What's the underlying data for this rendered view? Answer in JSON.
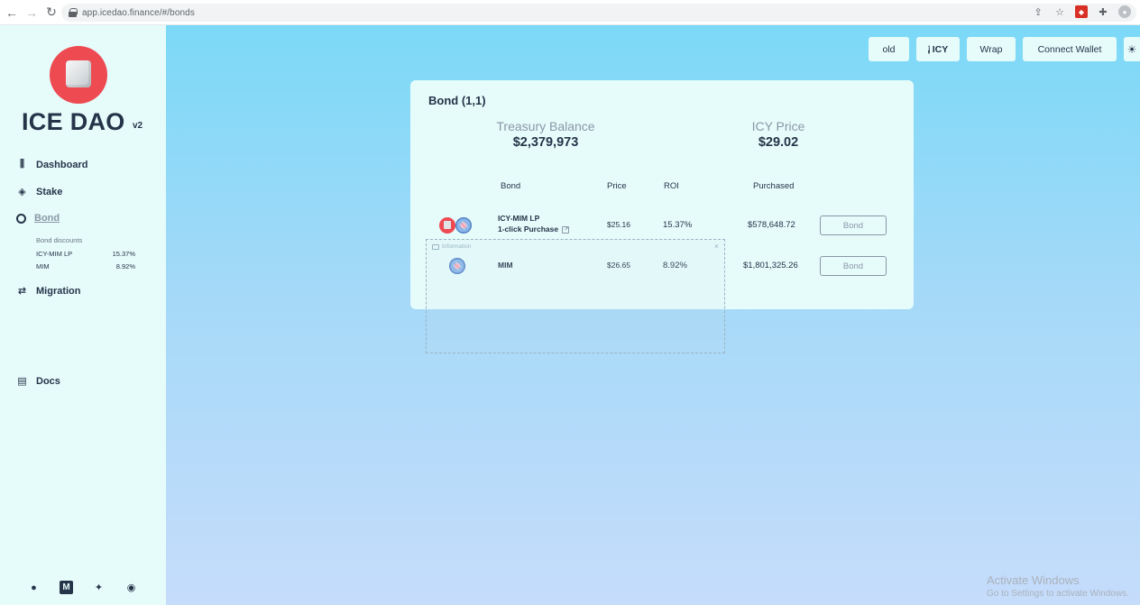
{
  "browser": {
    "url": "app.icedao.finance/#/bonds",
    "icons": [
      "back-arrow-icon",
      "forward-arrow-icon",
      "reload-icon",
      "lock-icon",
      "share-icon",
      "star-icon",
      "extension-icon",
      "puzzle-icon",
      "profile-icon"
    ]
  },
  "sidebar": {
    "brand": "ICE DAO",
    "version": "v2",
    "nav": [
      {
        "label": "Dashboard",
        "icon": "sliders-icon"
      },
      {
        "label": "Stake",
        "icon": "layers-icon"
      },
      {
        "label": "Bond",
        "icon": "bond-icon",
        "active": true
      },
      {
        "label": "Migration",
        "icon": "migration-icon"
      },
      {
        "label": "Docs",
        "icon": "docs-icon"
      }
    ],
    "discounts": {
      "title": "Bond discounts",
      "items": [
        {
          "name": "ICY-MIM LP",
          "value": "15.37%"
        },
        {
          "name": "MIM",
          "value": "8.92%"
        }
      ]
    },
    "socials": [
      "github-icon",
      "medium-icon",
      "twitter-icon",
      "discord-icon"
    ]
  },
  "topbar": {
    "old": "old",
    "icy": "ICY",
    "wrap": "Wrap",
    "connect": "Connect Wallet"
  },
  "card": {
    "title": "Bond (1,1)",
    "treasury_label": "Treasury Balance",
    "treasury_value": "$2,379,973",
    "price_label": "ICY Price",
    "price_value": "$29.02",
    "headers": {
      "bond": "Bond",
      "price": "Price",
      "roi": "ROI",
      "purchased": "Purchased"
    },
    "rows": [
      {
        "name": "ICY-MIM LP",
        "link": "1-click Purchase",
        "price": "$25.16",
        "roi": "15.37%",
        "purchased": "$578,648.72",
        "action": "Bond"
      },
      {
        "name": "MIM",
        "link": "",
        "price": "$26.65",
        "roi": "8.92%",
        "purchased": "$1,801,325.26",
        "action": "Bond"
      }
    ]
  },
  "overlay": {
    "title": "Information",
    "close": "×"
  },
  "watermark": {
    "title": "Activate Windows",
    "subtitle": "Go to Settings to activate Windows."
  },
  "colors": {
    "sidebar_bg": "#e6fcfb",
    "main_bg_top": "#7bd9f7",
    "main_bg_bottom": "#c6dcfb",
    "text": "#253449",
    "muted": "#8a97a6",
    "brand_red": "#ee4a52"
  }
}
